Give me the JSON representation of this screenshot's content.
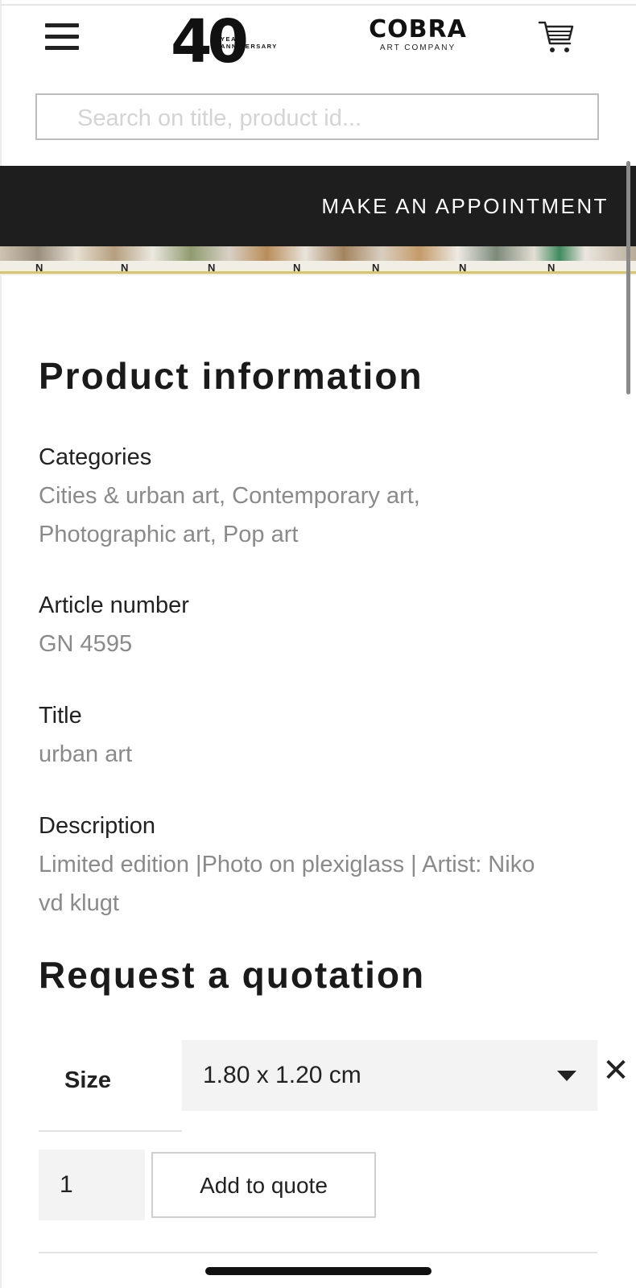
{
  "header": {
    "logo_anniversary": {
      "number": "40",
      "text_line1": "YEAR",
      "text_line2": "ANNIVERSARY"
    },
    "logo_brand": {
      "name": "COBRA",
      "subtitle": "ART COMPANY"
    },
    "menu_icon": "hamburger-menu-icon",
    "cart_icon": "shopping-cart-icon"
  },
  "search": {
    "placeholder": "Search on title, product id..."
  },
  "appointment": {
    "label": "MAKE AN APPOINTMENT"
  },
  "product_info": {
    "heading": "Product information",
    "categories_label": "Categories",
    "categories_line1": "Cities & urban art, Contemporary art,",
    "categories_line2": "Photographic art, Pop art",
    "article_label": "Article number",
    "article_value": "GN 4595",
    "title_label": "Title",
    "title_value": "urban art",
    "description_label": "Description",
    "description_line1": "Limited edition |Photo on plexiglass | Artist: Niko",
    "description_line2": "vd klugt"
  },
  "quotation": {
    "heading": "Request a quotation",
    "size_label": "Size",
    "size_selected": "1.80 x 1.20 cm",
    "clear_symbol": "✕",
    "quantity": "1",
    "add_button": "Add to quote"
  },
  "colors": {
    "appointment_bar": "#1e1e1e",
    "muted_text": "#8a8a8a",
    "field_bg": "#f3f3f3"
  }
}
